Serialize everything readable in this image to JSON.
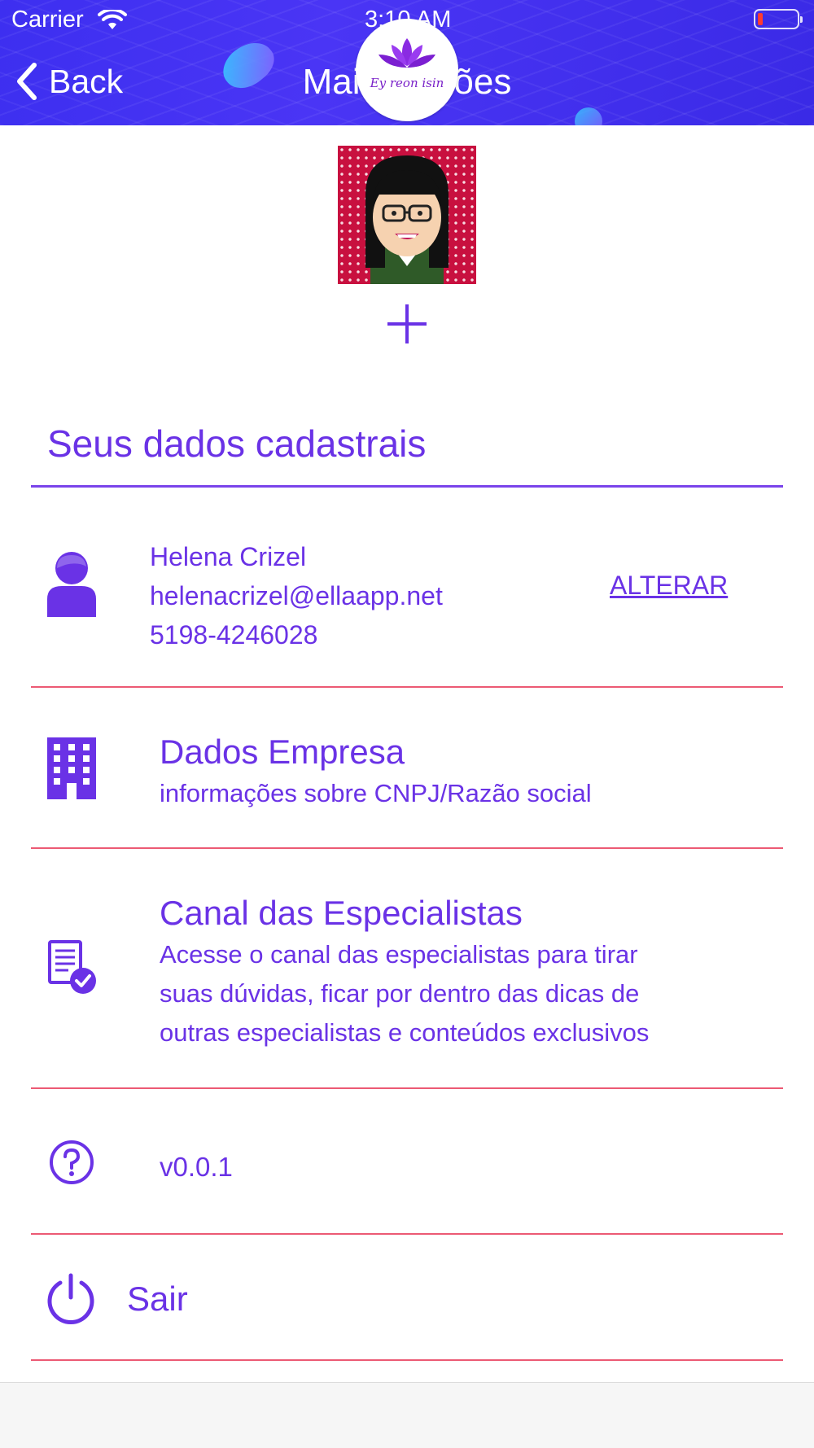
{
  "status_bar": {
    "carrier": "Carrier",
    "time": "3:10 AM",
    "battery_color": "#ff3b30"
  },
  "nav": {
    "back_label": "Back",
    "title": "Mais Opções",
    "logo_script": "Ey reon isin"
  },
  "profile": {
    "avatar_bg": "#c8103f"
  },
  "section": {
    "title": "Seus dados cadastrais"
  },
  "user": {
    "name": "Helena Crizel",
    "email": "helenacrizel@ellaapp.net",
    "phone": "5198-4246028",
    "edit_label": "ALTERAR"
  },
  "company": {
    "title": "Dados Empresa",
    "subtitle": "informações sobre CNPJ/Razão social"
  },
  "channel": {
    "title": "Canal das Especialistas",
    "line1": "Acesse o canal das especialistas para tirar",
    "line2": "suas dúvidas, ficar por dentro das dicas de",
    "line3": "outras especialistas e conteúdos exclusivos"
  },
  "version": {
    "label": "v0.0.1"
  },
  "logout": {
    "label": "Sair"
  },
  "colors": {
    "accent": "#6a32e6",
    "divider": "#ec5a74",
    "header": "#3d2ff0"
  },
  "icons": {
    "user": "person-icon",
    "company": "building-icon",
    "channel": "document-check-icon",
    "version": "question-circle-icon",
    "logout": "power-icon"
  }
}
